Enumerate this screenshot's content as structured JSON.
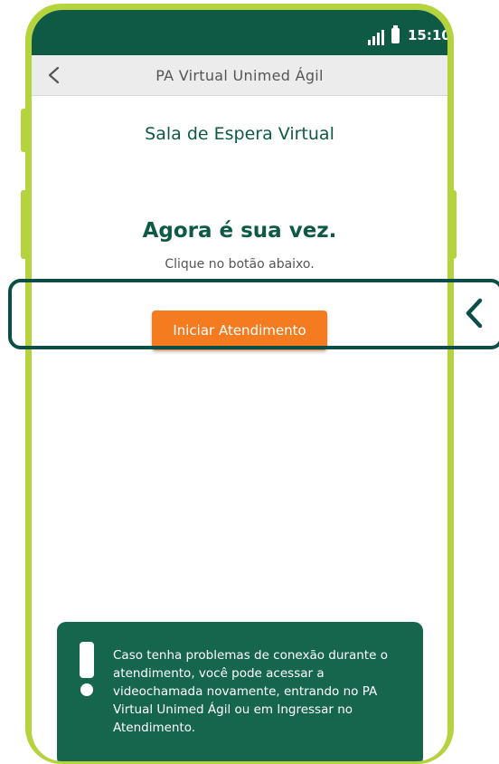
{
  "status_bar": {
    "time": "15:10",
    "icons": [
      "signal-icon",
      "battery-icon"
    ]
  },
  "app_bar": {
    "back_icon": "chevron-left-icon",
    "title": "PA Virtual Unimed Ágil"
  },
  "main": {
    "room_title": "Sala de Espera Virtual",
    "heading": "Agora é sua vez.",
    "instruction": "Clique no botão abaixo.",
    "start_button_label": "Iniciar Atendimento"
  },
  "notice": {
    "icon": "exclamation-icon",
    "text": "Caso tenha problemas de conexão durante o atendimento, você pode acessar a videochamada novamente, entrando no PA Virtual Unimed Ágil ou em Ingressar no Atendimento."
  },
  "overlay": {
    "indicator_icon": "chevron-left-icon"
  },
  "colors": {
    "frame": "#b5d33c",
    "brand_green": "#0e5a45",
    "notice_green": "#16664e",
    "button_orange": "#f47b20",
    "highlight": "#0b4d47"
  }
}
